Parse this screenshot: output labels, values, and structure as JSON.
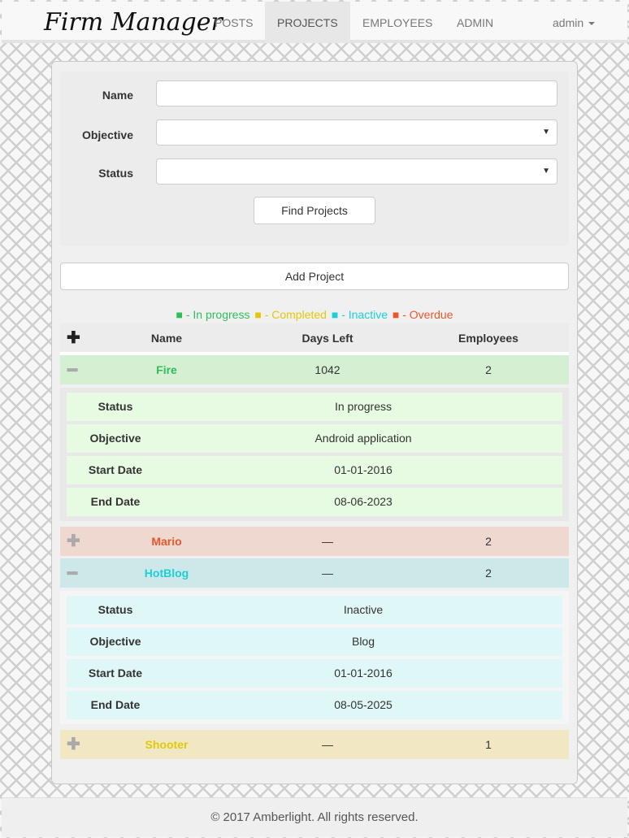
{
  "navbar": {
    "brand": "Firm Manager",
    "items": [
      "POSTS",
      "PROJECTS",
      "EMPLOYEES",
      "ADMIN"
    ],
    "active": "PROJECTS",
    "user": "admin"
  },
  "filter": {
    "name_label": "Name",
    "name_value": "",
    "objective_label": "Objective",
    "objective_value": "",
    "status_label": "Status",
    "status_value": "",
    "find_button": "Find Projects"
  },
  "add_button": "Add Project",
  "legend": {
    "in_progress": "■ - In progress",
    "completed": "■ - Completed",
    "inactive": "■ - Inactive",
    "overdue": "■ - Overdue",
    "colors": {
      "in_progress": "#2fbf5a",
      "completed": "#e0c90a",
      "inactive": "#1ccfd6",
      "overdue": "#e8572b"
    }
  },
  "table": {
    "toggle_all": "✚",
    "headers": {
      "name": "Name",
      "days_left": "Days Left",
      "employees": "Employees"
    },
    "detail_labels": {
      "status": "Status",
      "objective": "Objective",
      "start_date": "Start Date",
      "end_date": "End Date"
    },
    "projects": [
      {
        "toggle": "━",
        "name": "Fire",
        "days_left": "1042",
        "employees": "2",
        "status_key": "in_progress",
        "details": {
          "status": "In progress",
          "objective": "Android application",
          "start_date": "01-01-2016",
          "end_date": "08-06-2023"
        }
      },
      {
        "toggle": "✚",
        "name": "Mario",
        "days_left": "—",
        "employees": "2",
        "status_key": "overdue"
      },
      {
        "toggle": "━",
        "name": "HotBlog",
        "days_left": "—",
        "employees": "2",
        "status_key": "inactive",
        "details": {
          "status": "Inactive",
          "objective": "Blog",
          "start_date": "01-01-2016",
          "end_date": "08-05-2025"
        }
      },
      {
        "toggle": "✚",
        "name": "Shooter",
        "days_left": "—",
        "employees": "1",
        "status_key": "completed"
      }
    ]
  },
  "footer": "© 2017 Amberlight. All rights reserved."
}
